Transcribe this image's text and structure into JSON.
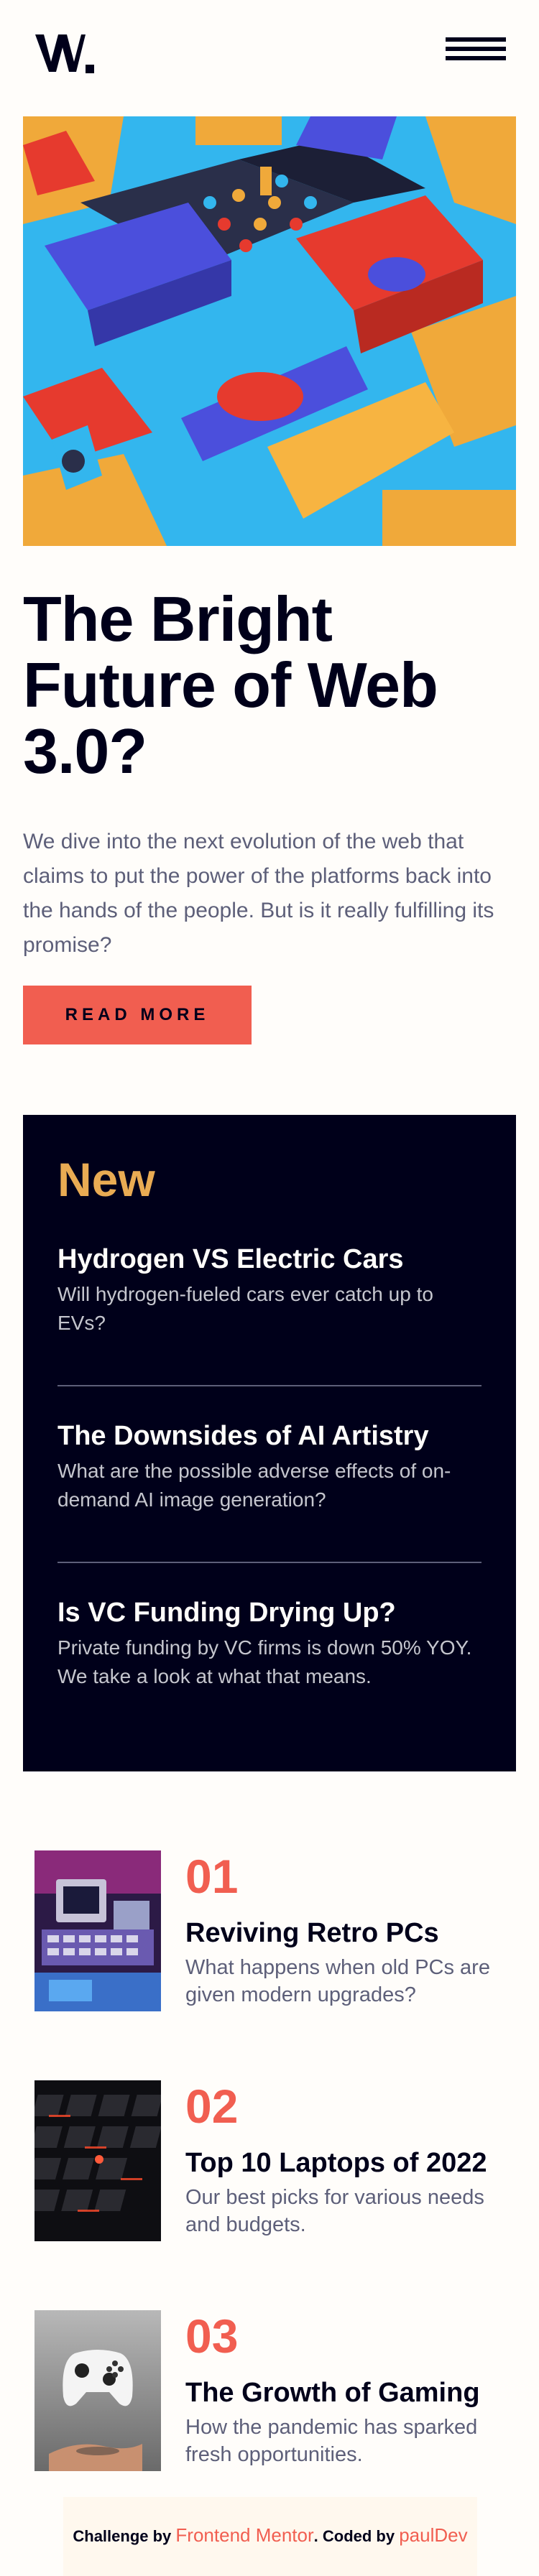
{
  "header": {
    "logo_text": "W.",
    "menu_icon": "hamburger-icon"
  },
  "hero": {
    "image_icon": "abstract-3d-shapes-image",
    "title": "The Bright Future of Web 3.0?",
    "description": "We dive into the next evolution of the web that claims to put the power of the platforms back into the hands of the people. But is it really fulfilling its promise?",
    "button_label": "READ MORE"
  },
  "new_section": {
    "title": "New",
    "items": [
      {
        "title": "Hydrogen VS Electric Cars",
        "description": "Will hydrogen-fueled cars ever catch up to EVs?"
      },
      {
        "title": "The Downsides of AI Artistry",
        "description": "What are the possible adverse effects of on-demand AI image generation?"
      },
      {
        "title": "Is VC Funding Drying Up?",
        "description": "Private funding by VC firms is down 50% YOY. We take a look at what that means."
      }
    ]
  },
  "numbered": [
    {
      "number": "01",
      "title": "Reviving Retro PCs",
      "description": "What happens when old PCs are given modern upgrades?",
      "image_icon": "retro-pc-image"
    },
    {
      "number": "02",
      "title": "Top 10 Laptops of 2022",
      "description": "Our best picks for various needs and budgets.",
      "image_icon": "laptop-keyboard-image"
    },
    {
      "number": "03",
      "title": "The Growth of Gaming",
      "description": "How the pandemic has sparked fresh opportunities.",
      "image_icon": "game-controller-image"
    }
  ],
  "attribution": {
    "prefix": "Challenge by ",
    "link1": "Frontend Mentor",
    "middle": ". Coded by ",
    "link2": "paulDev"
  },
  "colors": {
    "accent_red": "#f15e50",
    "accent_orange": "#e9ab53",
    "dark_navy": "#00001a",
    "off_white": "#fffdfa",
    "grayish_blue": "#5d5f79"
  }
}
